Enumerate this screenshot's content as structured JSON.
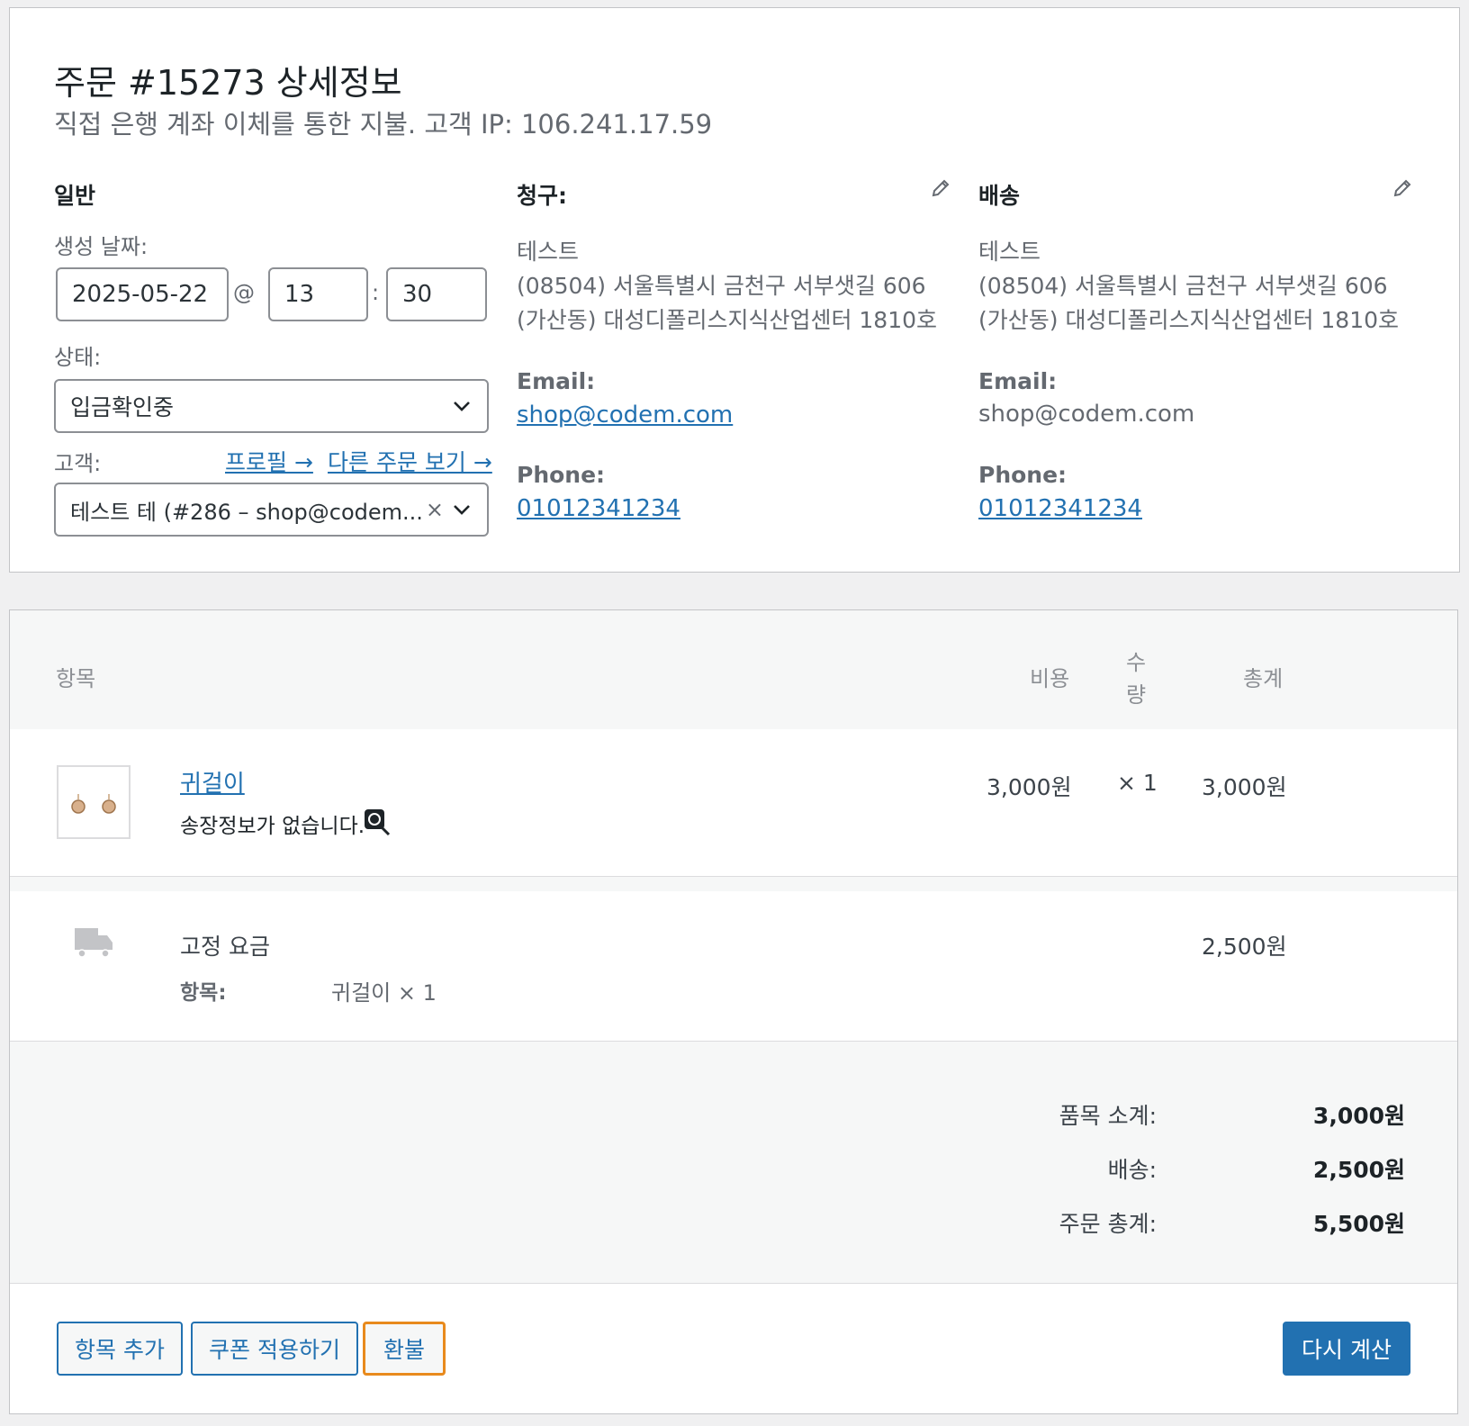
{
  "order": {
    "title": "주문 #15273 상세정보",
    "subtitle": "직접 은행 계좌 이체를 통한 지불. 고객 IP: 106.241.17.59"
  },
  "general": {
    "heading": "일반",
    "date_label": "생성 날짜:",
    "date_value": "2025-05-22",
    "at_sign": "@",
    "hour_value": "13",
    "colon": ":",
    "minute_value": "30",
    "status_label": "상태:",
    "status_value": "입금확인중",
    "customer_label": "고객:",
    "profile_link": "프로필 →",
    "other_orders_link": "다른 주문 보기 →",
    "customer_value": "테스트 테 (#286 – shop@codem...",
    "clear_glyph": "×"
  },
  "billing": {
    "heading": "청구:",
    "name": "테스트",
    "address_line1": "(08504) 서울특별시 금천구 서부샛길 606",
    "address_line2": "(가산동) 대성디폴리스지식산업센터 1810호",
    "email_label": "Email:",
    "email": "shop@codem.com",
    "phone_label": "Phone:",
    "phone": "01012341234"
  },
  "shipping": {
    "heading": "배송",
    "name": "테스트",
    "address_line1": "(08504) 서울특별시 금천구 서부샛길 606",
    "address_line2": "(가산동) 대성디폴리스지식산업센터 1810호",
    "email_label": "Email:",
    "email": "shop@codem.com",
    "phone_label": "Phone:",
    "phone": "01012341234"
  },
  "items_table": {
    "headers": {
      "item": "항목",
      "cost": "비용",
      "qty_line1": "수",
      "qty_line2": "량",
      "total": "총계"
    },
    "line_item": {
      "name": "귀걸이",
      "note": "송장정보가 없습니다.",
      "cost": "3,000원",
      "qty": "× 1",
      "total": "3,000원"
    },
    "shipping_item": {
      "name": "고정 요금",
      "meta_label": "항목:",
      "meta_value": "귀걸이 × 1",
      "total": "2,500원"
    }
  },
  "totals": {
    "subtotal_label": "품목 소계:",
    "subtotal": "3,000원",
    "shipping_label": "배송:",
    "shipping": "2,500원",
    "order_total_label": "주문 총계:",
    "order_total": "5,500원"
  },
  "actions": {
    "add_item": "항목 추가",
    "apply_coupon": "쿠폰 적용하기",
    "refund": "환불",
    "recalculate": "다시 계산"
  },
  "colors": {
    "accent": "#2271b1",
    "focus": "#e88a1d"
  }
}
